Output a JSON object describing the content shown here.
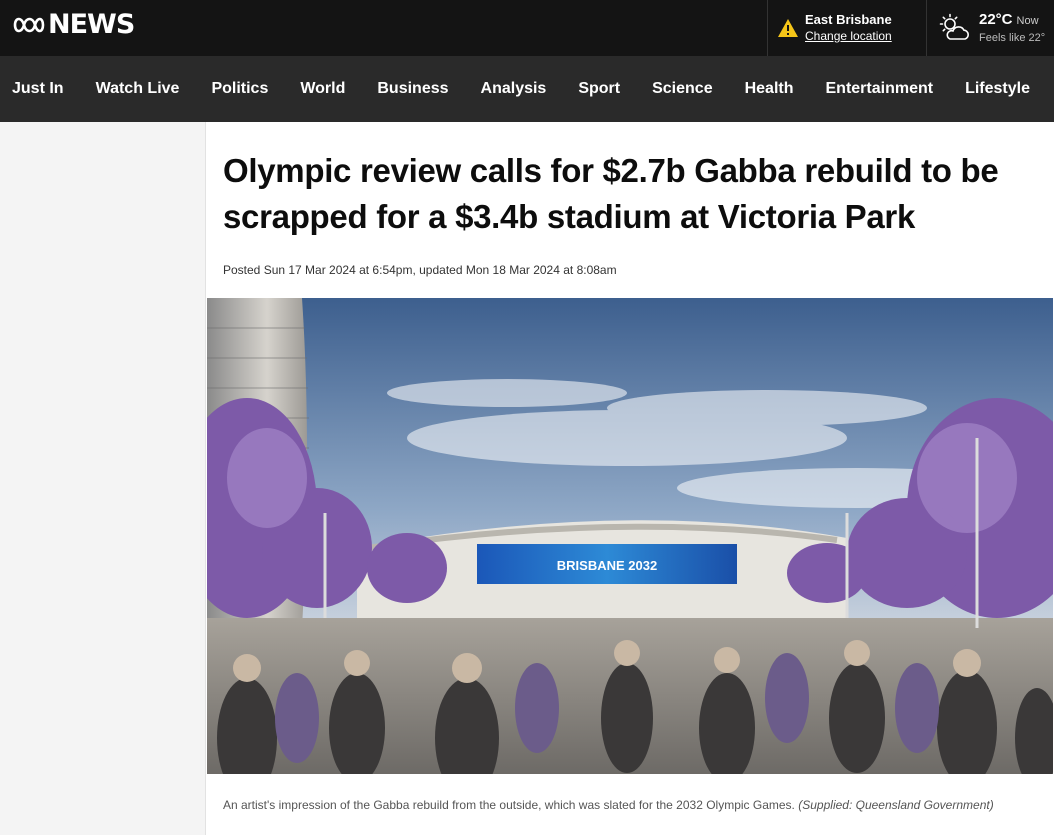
{
  "header": {
    "logo_text": "NEWS",
    "location": {
      "name": "East Brisbane",
      "change_label": "Change location",
      "icon": "warning-icon"
    },
    "weather": {
      "temperature": "22°C",
      "time": "Now",
      "feels_like": "Feels like 22°",
      "icon": "partly-cloudy-icon"
    }
  },
  "nav": {
    "items": [
      "Just In",
      "Watch Live",
      "Politics",
      "World",
      "Business",
      "Analysis",
      "Sport",
      "Science",
      "Health",
      "Entertainment",
      "Lifestyle"
    ]
  },
  "article": {
    "headline": "Olympic review calls for $2.7b Gabba rebuild to be scrapped for a $3.4b stadium at Victoria Park",
    "dateline": "Posted Sun 17 Mar 2024 at 6:54pm, updated Mon 18 Mar 2024 at 8:08am",
    "image": {
      "screen_text": "BRISBANE 2032",
      "caption": "An artist's impression of the Gabba rebuild from the outside, which was slated for the 2032 Olympic Games.",
      "credit": "(Supplied: Queensland Government)"
    }
  },
  "colors": {
    "topbar": "#141414",
    "nav": "#2a2a2a",
    "warning": "#f5c518"
  }
}
